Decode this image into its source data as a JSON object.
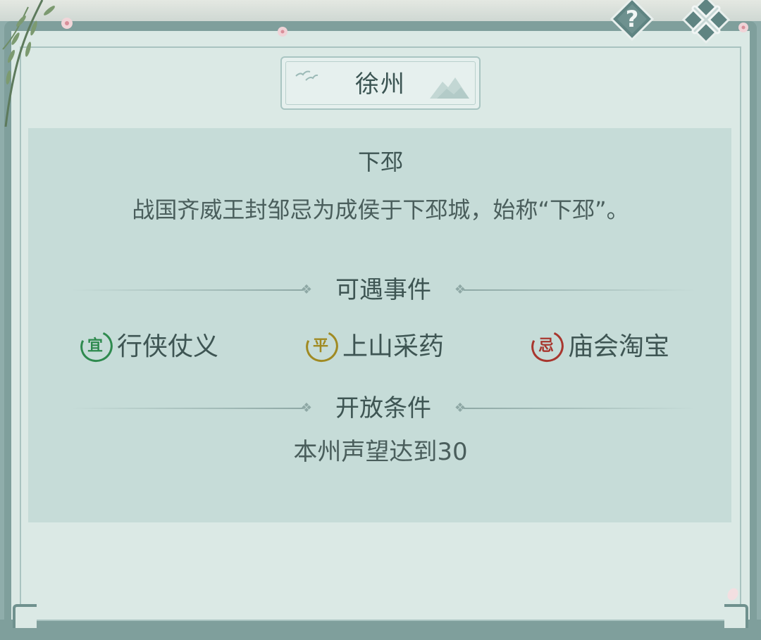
{
  "region": {
    "title": "徐州"
  },
  "place": {
    "name": "下邳",
    "description": "战国齐威王封邹忌为成侯于下邳城，始称“下邳”。"
  },
  "events": {
    "heading": "可遇事件",
    "items": [
      {
        "badge": "宜",
        "label": "行侠仗义",
        "color": "#2e8a4e"
      },
      {
        "badge": "平",
        "label": "上山采药",
        "color": "#a08a22"
      },
      {
        "badge": "忌",
        "label": "庙会淘宝",
        "color": "#a8362e"
      }
    ]
  },
  "unlock": {
    "heading": "开放条件",
    "condition": "本州声望达到30"
  },
  "buttons": {
    "help_icon": "question-icon",
    "close_icon": "close-icon"
  }
}
